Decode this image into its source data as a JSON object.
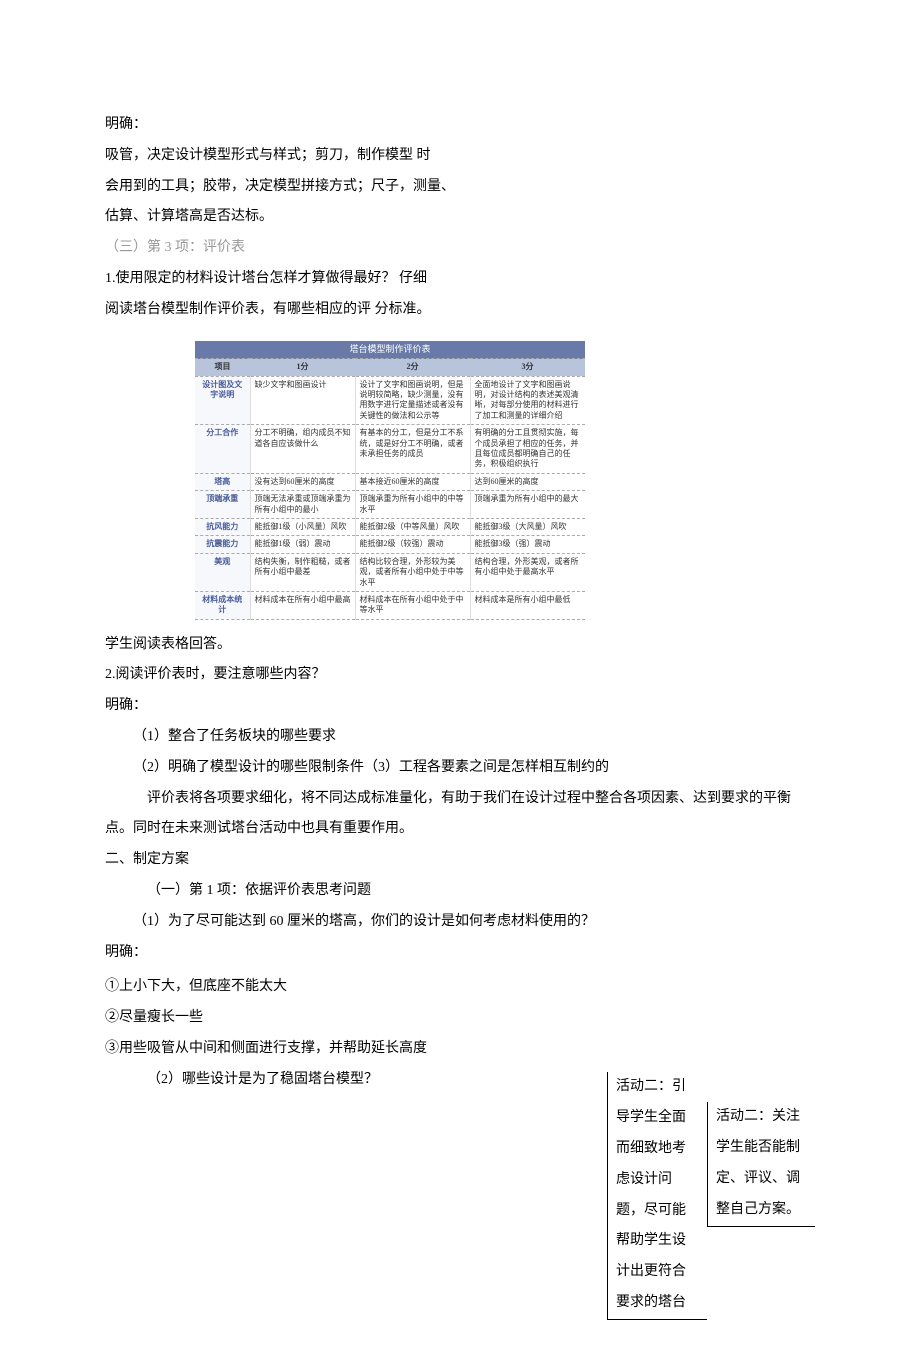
{
  "p1": "明确：",
  "p2": "吸管，决定设计模型形式与样式；剪刀，制作模型 时",
  "p3": "会用到的工具；胶带，决定模型拼接方式；尺子，测量、",
  "p4": "估算、计算塔高是否达标。",
  "p5": "（三）第 3 项：评价表",
  "p6": "1.使用限定的材料设计塔台怎样才算做得最好？ 仔细",
  "p7": "阅读塔台模型制作评价表，有哪些相应的评 分标准。",
  "table": {
    "title": "塔台模型制作评价表",
    "headers": [
      "项目",
      "1分",
      "2分",
      "3分"
    ],
    "rows": [
      {
        "label": "设计图及文字说明",
        "c1": "缺少文字和图画设计",
        "c2": "设计了文字和图画说明，但是说明较简略，缺少测量，没有用数字进行定量描述或者没有关键性的做法和公示等",
        "c3": "全面地设计了文字和图画说明，对设计结构的表述美观清晰，对每部分使用的材料进行了加工和测量的详细介绍"
      },
      {
        "label": "分工合作",
        "c1": "分工不明确，组内成员不知道各自应该做什么",
        "c2": "有基本的分工，但是分工不系统，或是好分工不明确，或者未承担任务的成员",
        "c3": "有明确的分工且贯彻实施，每个成员承担了相应的任务，并且每位成员都明确自己的任务，积极组织执行"
      },
      {
        "label": "塔高",
        "c1": "没有达到60厘米的高度",
        "c2": "基本接近60厘米的高度",
        "c3": "达到60厘米的高度"
      },
      {
        "label": "顶端承重",
        "c1": "顶端无法承重或顶端承重为所有小组中的最小",
        "c2": "顶端承重为所有小组中的中等水平",
        "c3": "顶端承重为所有小组中的最大"
      },
      {
        "label": "抗风能力",
        "c1": "能抵御1级（小风量）风吹",
        "c2": "能抵御2级（中等风量）风吹",
        "c3": "能抵御3级（大风量）风吹"
      },
      {
        "label": "抗震能力",
        "c1": "能抵御1级（弱）震动",
        "c2": "能抵御2级（较强）震动",
        "c3": "能抵御3级（强）震动"
      },
      {
        "label": "美观",
        "c1": "结构失衡，制作粗糙，或者所有小组中最差",
        "c2": "结构比较合理，外形较为美观，或者所有小组中处于中等水平",
        "c3": "结构合理，外形美观，或者所有小组中处于最高水平"
      },
      {
        "label": "材料成本统计",
        "c1": "材料成本在所有小组中最高",
        "c2": "材料成本在所有小组中处于中等水平",
        "c3": "材料成本是所有小组中最低"
      }
    ]
  },
  "p8": "学生阅读表格回答。",
  "p9": "2.阅读评价表时，要注意哪些内容？",
  "p10": "明确：",
  "p11": "（1）整合了任务板块的哪些要求",
  "p12": "（2）明确了模型设计的哪些限制条件（3）工程各要素之间是怎样相互制约的",
  "p13": "评价表将各项要求细化，将不同达成标准量化，有助于我们在设计过程中整合各项因素、达到要求的平衡点。同时在未来测试塔台活动中也具有重要作用。",
  "p14": "二、制定方案",
  "p15": "（一）第 1 项：依据评价表思考问题",
  "p16": "（1）为了尽可能达到 60 厘米的塔高，你们的设计是如何考虑材料使用的？",
  "p17": "明确：",
  "p18": "①上小下大，但底座不能太大",
  "p19": "②尽量瘦长一些",
  "p20": "③用些吸管从中间和侧面进行支撑，并帮助延长高度",
  "p21": "（2）哪些设计是为了稳固塔台模型？",
  "side1": "活动二：引导学生全面而细致地考虑设计问题，尽可能帮助学生设计出更符合要求的塔台",
  "side2": "活动二：关注学生能否能制定、评议、调整自己方案。"
}
